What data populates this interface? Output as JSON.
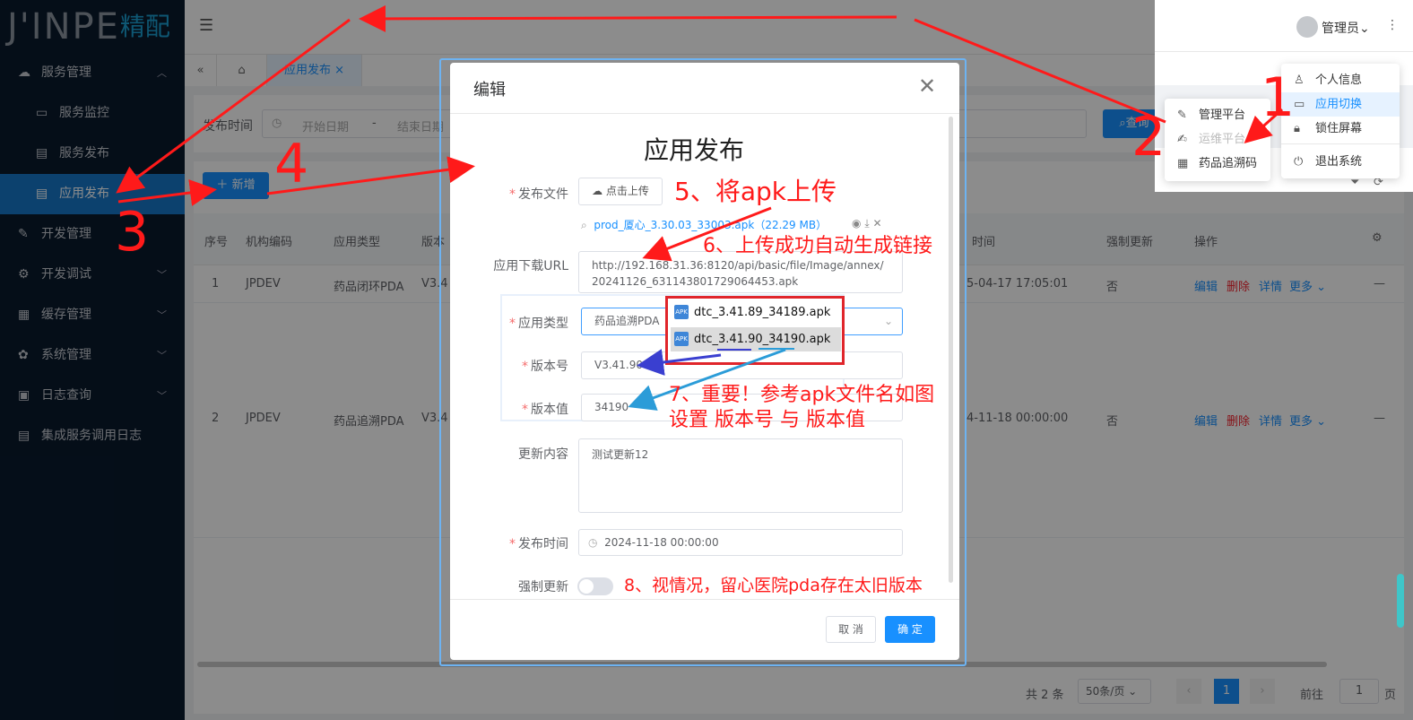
{
  "app": {
    "logo_main": "J'INPE",
    "logo_cn": "精配"
  },
  "sidebar": {
    "items": [
      {
        "label": "服务管理",
        "icon": "cloud-icon",
        "chevron": "up"
      },
      {
        "label": "服务监控",
        "icon": "monitor-icon",
        "sub": true
      },
      {
        "label": "服务发布",
        "icon": "document-icon",
        "sub": true
      },
      {
        "label": "应用发布",
        "icon": "document-icon",
        "sub": true,
        "active": true
      },
      {
        "label": "开发管理",
        "icon": "edit-icon"
      },
      {
        "label": "开发调试",
        "icon": "bug-icon",
        "chevron": "down"
      },
      {
        "label": "缓存管理",
        "icon": "chart-icon",
        "chevron": "down"
      },
      {
        "label": "系统管理",
        "icon": "apps-icon",
        "chevron": "down"
      },
      {
        "label": "日志查询",
        "icon": "log-icon",
        "chevron": "down"
      },
      {
        "label": "集成服务调用日志",
        "icon": "list-icon"
      }
    ]
  },
  "header": {
    "user": "管理员"
  },
  "tabs": {
    "active_tab": "应用发布"
  },
  "search": {
    "label": "发布时间",
    "start_placeholder": "开始日期",
    "separator": "-",
    "end_placeholder": "结束日期",
    "query_button": "查询"
  },
  "toolbar": {
    "add_button": "新增"
  },
  "table": {
    "columns": [
      "序号",
      "机构编码",
      "应用类型",
      "版本",
      "时间",
      "强制更新",
      "操作"
    ],
    "rows": [
      {
        "index": "1",
        "org": "JPDEV",
        "type": "药品闭环PDA",
        "version": "V3.4",
        "time": "5-04-17 17:05:01",
        "force": "否"
      },
      {
        "index": "2",
        "org": "JPDEV",
        "type": "药品追溯PDA",
        "version": "V3.4",
        "time": "4-11-18 00:00:00",
        "force": "否"
      }
    ],
    "actions": {
      "edit": "编辑",
      "delete": "删除",
      "detail": "详情",
      "more": "更多"
    },
    "dash": "—"
  },
  "pagination": {
    "total": "共 2 条",
    "page_size": "50条/页",
    "current": "1",
    "goto": "前往",
    "goto_value": "1",
    "page_unit": "页"
  },
  "dialog": {
    "title": "编辑",
    "heading": "应用发布",
    "labels": {
      "file": "发布文件",
      "url": "应用下载URL",
      "type": "应用类型",
      "version": "版本号",
      "version_value": "版本值",
      "content": "更新内容",
      "time": "发布时间",
      "force": "强制更新"
    },
    "upload_button": "点击上传",
    "uploaded_file": "prod_厦心_3.30.03_33003.apk（22.29 MB）",
    "url_value": "http://192.168.31.36:8120/api/basic/file/Image/annex/20241126_631143801729064453.apk",
    "type_value": "药品追溯PDA",
    "version": "V3.41.90",
    "version_value": "34190",
    "content": "测试更新12",
    "time": "2024-11-18 00:00:00",
    "cancel": "取 消",
    "confirm": "确 定"
  },
  "file_popup": {
    "files": [
      "dtc_3.41.89_34189.apk",
      "dtc_3.41.90_34190.apk"
    ]
  },
  "dropdown_app": {
    "items": [
      {
        "label": "管理平台",
        "icon": "pen-icon"
      },
      {
        "label": "运维平台",
        "icon": "edit-icon",
        "disabled": true
      },
      {
        "label": "药品追溯码",
        "icon": "qrcode-icon"
      }
    ]
  },
  "dropdown_user": {
    "items": [
      {
        "label": "个人信息",
        "icon": "user-icon"
      },
      {
        "label": "应用切换",
        "icon": "switch-icon",
        "active": true
      },
      {
        "label": "锁住屏幕",
        "icon": "lock-icon"
      },
      {
        "label": "退出系统",
        "icon": "power-icon"
      }
    ]
  },
  "annotations": {
    "n1": "1",
    "n2": "2",
    "n3": "3",
    "n4": "4",
    "step5": "5、将apk上传",
    "step6": "6、上传成功自动生成链接",
    "step7_line1": "7、重要！参考apk文件名如图",
    "step7_line2": "设置 版本号 与 版本值",
    "step8": "8、视情况，留心医院pda存在太旧版本"
  },
  "colors": {
    "sidebar": "#0a1a2d",
    "primary": "#1890ff",
    "annotation": "#ff1a1a",
    "arrow_blue": "#2b9cd8",
    "arrow_indigo": "#3a3fd0"
  }
}
